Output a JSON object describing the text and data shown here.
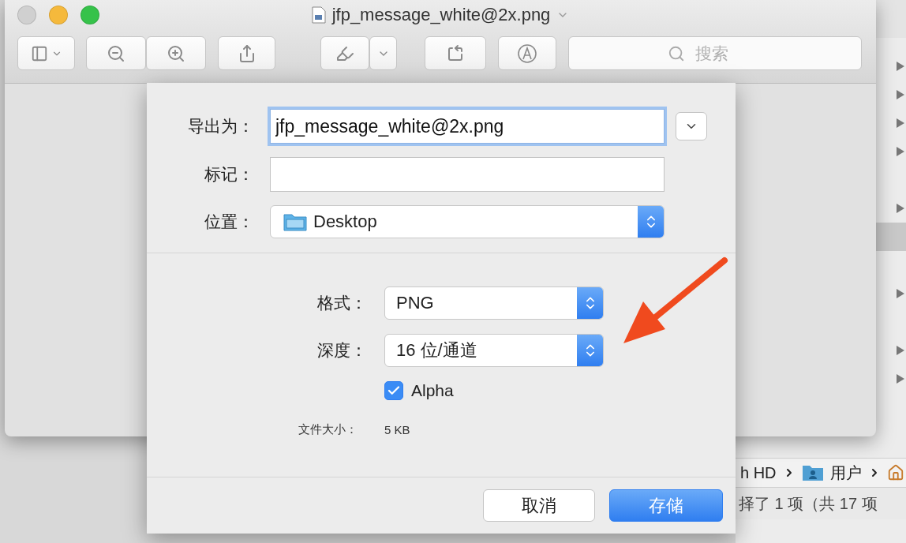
{
  "background_window": {
    "rows": [
      {
        "expandable": true,
        "selected": false
      },
      {
        "expandable": true,
        "selected": false
      },
      {
        "expandable": true,
        "selected": false
      },
      {
        "expandable": true,
        "selected": false
      },
      {
        "expandable": false,
        "selected": false
      },
      {
        "expandable": true,
        "selected": false
      },
      {
        "expandable": false,
        "selected": true
      },
      {
        "expandable": false,
        "selected": false
      },
      {
        "expandable": true,
        "selected": false
      },
      {
        "expandable": false,
        "selected": false
      },
      {
        "expandable": true,
        "selected": false
      },
      {
        "expandable": true,
        "selected": false
      }
    ],
    "path": [
      "h HD",
      "用户"
    ],
    "status": "择了 1 项（共 17 项"
  },
  "window": {
    "title": "jfp_message_white@2x.png",
    "search": {
      "placeholder": "搜索"
    }
  },
  "dialog": {
    "fields": [
      {
        "kind": "text",
        "label": "导出为：",
        "value": "jfp_message_white@2x.png",
        "focused": true
      },
      {
        "kind": "text",
        "label": "标记：",
        "focused": false
      },
      {
        "kind": "popup",
        "label": "位置：",
        "value": "Desktop"
      }
    ],
    "options": [
      {
        "kind": "popup",
        "label": "格式：",
        "value": "PNG"
      },
      {
        "kind": "popup",
        "label": "深度：",
        "value": "16 位/通道"
      },
      {
        "kind": "checkbox",
        "label": "Alpha",
        "checked": true
      },
      {
        "kind": "info",
        "label": "文件大小：",
        "value": "5 KB"
      }
    ],
    "buttons": [
      {
        "label": "取消",
        "default": false
      },
      {
        "label": "存储",
        "default": true
      }
    ]
  }
}
